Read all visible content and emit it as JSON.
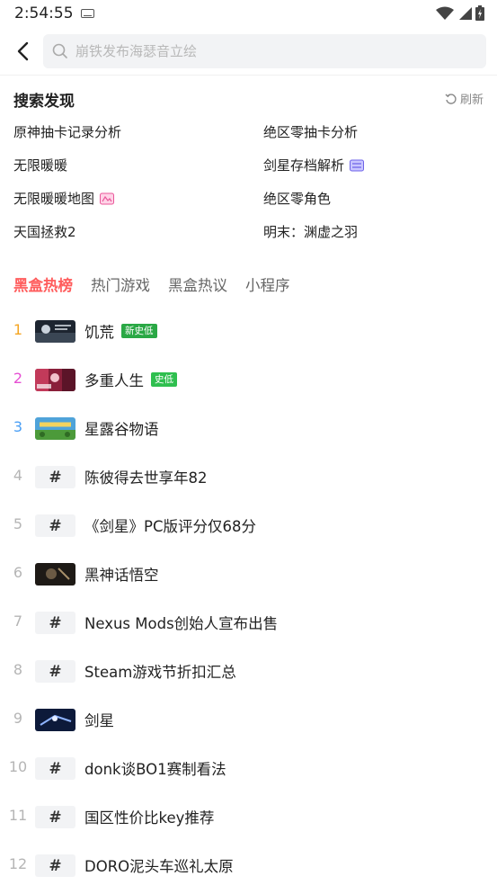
{
  "status": {
    "time": "2:54:55"
  },
  "search": {
    "placeholder": "崩铁发布海瑟音立绘",
    "value": ""
  },
  "discover": {
    "title": "搜索发现",
    "refresh_label": "刷新",
    "items": [
      {
        "label": "原神抽卡记录分析",
        "icon": ""
      },
      {
        "label": "绝区零抽卡分析",
        "icon": ""
      },
      {
        "label": "无限暖暖",
        "icon": ""
      },
      {
        "label": "剑星存档解析",
        "icon": "new-tag-icon"
      },
      {
        "label": "无限暖暖地图",
        "icon": "map-tag-icon"
      },
      {
        "label": "绝区零角色",
        "icon": ""
      },
      {
        "label": "天国拯救2",
        "icon": ""
      },
      {
        "label": "明末：渊虚之羽",
        "icon": ""
      }
    ]
  },
  "tabs": [
    {
      "label": "黑盒热榜",
      "active": true
    },
    {
      "label": "热门游戏",
      "active": false
    },
    {
      "label": "黑盒热议",
      "active": false
    },
    {
      "label": "小程序",
      "active": false
    }
  ],
  "ranking": [
    {
      "rank": "1",
      "title": "饥荒",
      "kind": "game",
      "badge": "新史低",
      "badge_color": "#2aa845",
      "rank_color": "#f5a623"
    },
    {
      "rank": "2",
      "title": "多重人生",
      "kind": "game",
      "badge": "史低",
      "badge_color": "#2fbf4f",
      "rank_color": "#e64fd3"
    },
    {
      "rank": "3",
      "title": "星露谷物语",
      "kind": "game",
      "badge": "",
      "rank_color": "#4a9ff5"
    },
    {
      "rank": "4",
      "title": "陈彼得去世享年82",
      "kind": "topic",
      "badge": ""
    },
    {
      "rank": "5",
      "title": "《剑星》PC版评分仅68分",
      "kind": "topic",
      "badge": ""
    },
    {
      "rank": "6",
      "title": "黑神话悟空",
      "kind": "game",
      "badge": ""
    },
    {
      "rank": "7",
      "title": "Nexus Mods创始人宣布出售",
      "kind": "topic",
      "badge": ""
    },
    {
      "rank": "8",
      "title": "Steam游戏节折扣汇总",
      "kind": "topic",
      "badge": ""
    },
    {
      "rank": "9",
      "title": "剑星",
      "kind": "game",
      "badge": ""
    },
    {
      "rank": "10",
      "title": "donk谈BO1赛制看法",
      "kind": "topic",
      "badge": ""
    },
    {
      "rank": "11",
      "title": "国区性价比key推荐",
      "kind": "topic",
      "badge": ""
    },
    {
      "rank": "12",
      "title": "DORO泥头车巡礼太原",
      "kind": "topic",
      "badge": ""
    }
  ],
  "hash_symbol": "#",
  "colors": {
    "accent": "#ff5c5c"
  }
}
